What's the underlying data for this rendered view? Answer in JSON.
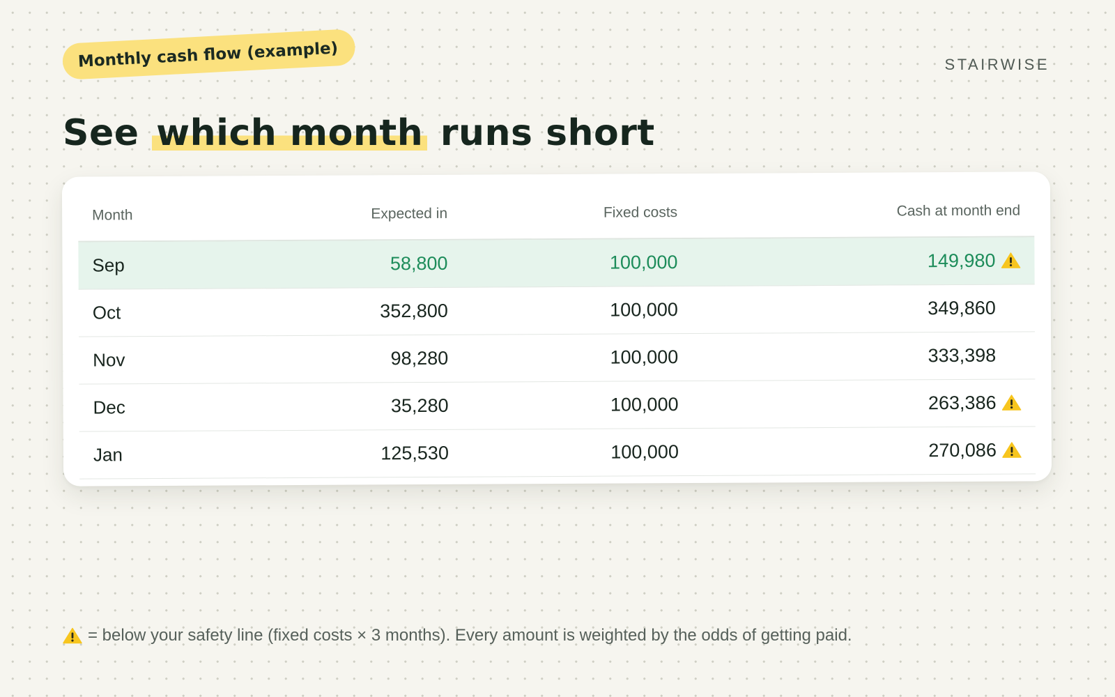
{
  "header": {
    "tag": "Monthly cash flow (example)",
    "brand": "STAIRWISE",
    "title_before": "See ",
    "title_highlight": "which month",
    "title_after": " runs short"
  },
  "table": {
    "columns": [
      "Month",
      "Expected in",
      "Fixed costs",
      "Cash at month end"
    ],
    "rows": [
      {
        "month": "Sep",
        "expected_in": "58,800",
        "fixed_costs": "100,000",
        "cash_end": "149,980",
        "warning": true,
        "highlighted": true
      },
      {
        "month": "Oct",
        "expected_in": "352,800",
        "fixed_costs": "100,000",
        "cash_end": "349,860",
        "warning": false,
        "highlighted": false
      },
      {
        "month": "Nov",
        "expected_in": "98,280",
        "fixed_costs": "100,000",
        "cash_end": "333,398",
        "warning": false,
        "highlighted": false
      },
      {
        "month": "Dec",
        "expected_in": "35,280",
        "fixed_costs": "100,000",
        "cash_end": "263,386",
        "warning": true,
        "highlighted": false
      },
      {
        "month": "Jan",
        "expected_in": "125,530",
        "fixed_costs": "100,000",
        "cash_end": "270,086",
        "warning": true,
        "highlighted": false
      }
    ]
  },
  "footnote": {
    "text": "= below your safety line (fixed costs × 3 months). Every amount is weighted by the odds of getting paid."
  },
  "colors": {
    "background": "#f6f5ef",
    "highlight_yellow": "#fbe17e",
    "accent_green": "#1d8c5a",
    "row_highlight": "#e6f4ec",
    "warning_yellow": "#f7c51e"
  },
  "icons": {
    "warning": "warning-triangle-icon"
  }
}
